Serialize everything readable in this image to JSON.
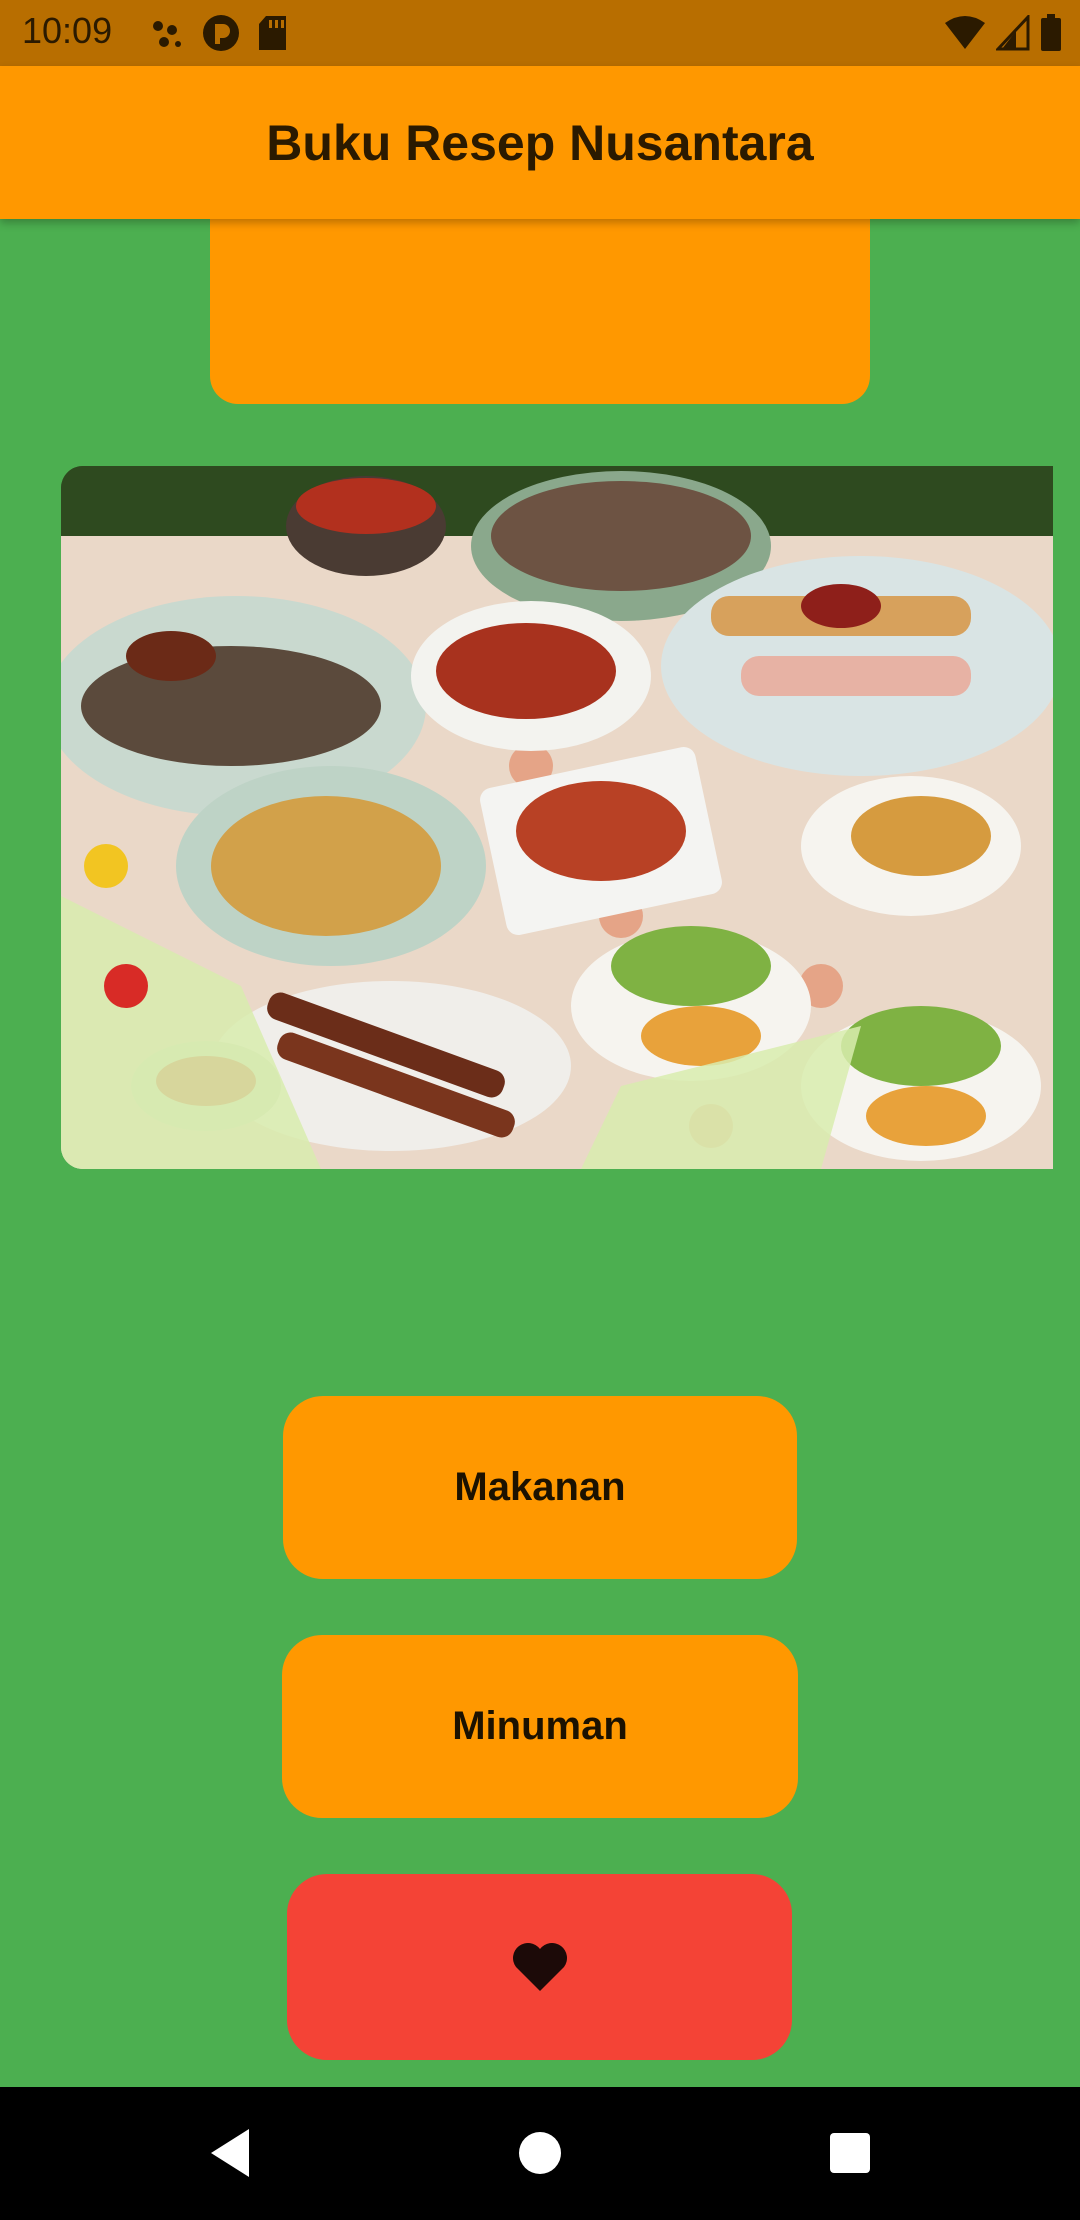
{
  "status_bar": {
    "time": "10:09",
    "left_icons": [
      "dots-icon",
      "pocket-icon",
      "sd-card-icon"
    ],
    "right_icons": [
      "wifi-icon",
      "signal-icon",
      "battery-icon"
    ]
  },
  "app_bar": {
    "title": "Buku Resep Nusantara"
  },
  "hero_image": {
    "icon": "indonesian-food-spread-image"
  },
  "buttons": {
    "makanan": "Makanan",
    "minuman": "Minuman",
    "favorite_icon": "heart-icon"
  },
  "nav_bar": {
    "icons": [
      "back-icon",
      "home-icon",
      "recents-icon"
    ]
  },
  "colors": {
    "background": "#4caf50",
    "primary": "#ff9800",
    "favorite": "#f44336",
    "status_bar": "#b86e00"
  }
}
